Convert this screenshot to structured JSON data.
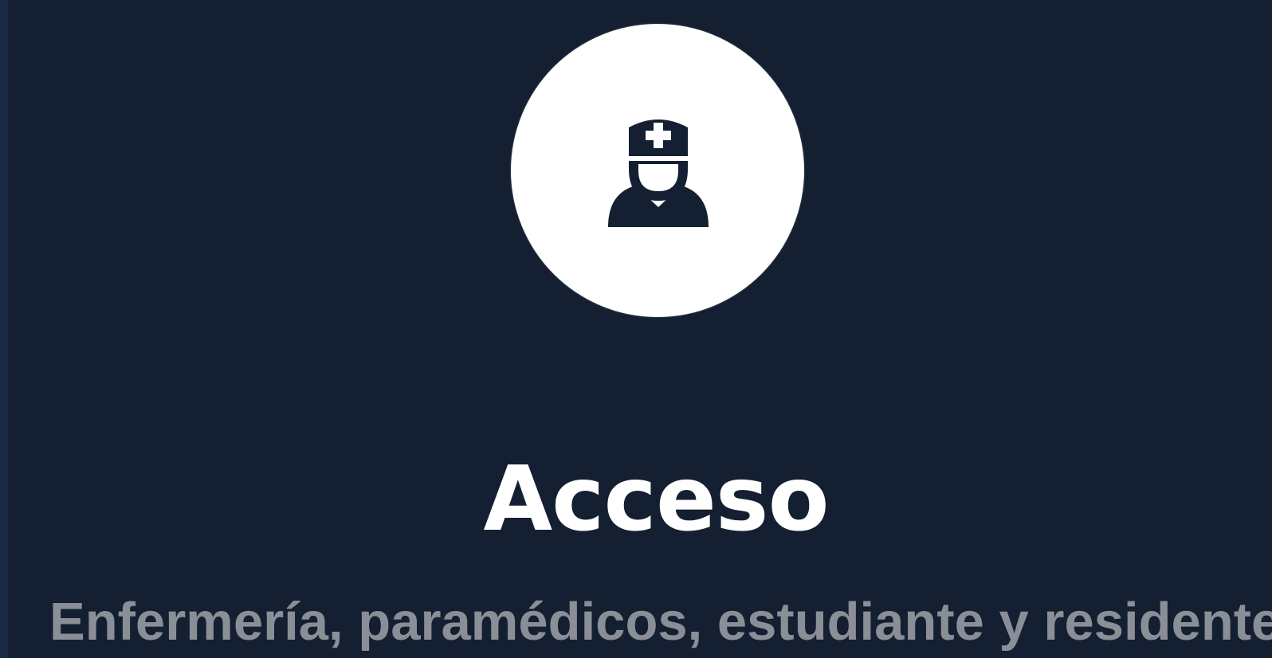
{
  "colors": {
    "page_background": "#1b2a44",
    "card_background": "#141f31",
    "avatar_circle": "#ffffff",
    "icon": "#141f31",
    "title_text": "#ffffff",
    "subtitle_text": "#8a8e96"
  },
  "card": {
    "icon": "doctor-icon",
    "title": "Acceso",
    "subtitle": "Enfermería, paramédicos, estudiante y residentes"
  }
}
